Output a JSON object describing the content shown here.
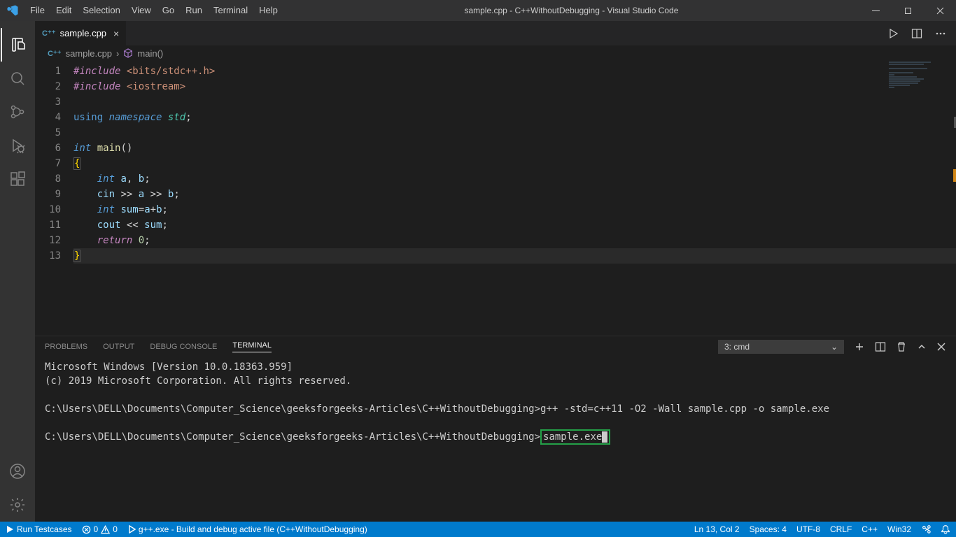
{
  "titlebar": {
    "menus": [
      "File",
      "Edit",
      "Selection",
      "View",
      "Go",
      "Run",
      "Terminal",
      "Help"
    ],
    "title": "sample.cpp - C++WithoutDebugging - Visual Studio Code"
  },
  "tab": {
    "filename": "sample.cpp"
  },
  "breadcrumb": {
    "file": "sample.cpp",
    "symbol": "main()"
  },
  "code": {
    "lines": [
      1,
      2,
      3,
      4,
      5,
      6,
      7,
      8,
      9,
      10,
      11,
      12,
      13
    ]
  },
  "panel": {
    "tabs": [
      "PROBLEMS",
      "OUTPUT",
      "DEBUG CONSOLE",
      "TERMINAL"
    ],
    "active_tab": "TERMINAL",
    "terminal_select": "3: cmd",
    "terminal_lines": {
      "l1": "Microsoft Windows [Version 10.0.18363.959]",
      "l2": "(c) 2019 Microsoft Corporation. All rights reserved.",
      "l3": "C:\\Users\\DELL\\Documents\\Computer_Science\\geeksforgeeks-Articles\\C++WithoutDebugging>g++ -std=c++11 -O2 -Wall sample.cpp -o sample.exe",
      "l4_prefix": "C:\\Users\\DELL\\Documents\\Computer_Science\\geeksforgeeks-Articles\\C++WithoutDebugging>",
      "l4_cmd": "sample.exe"
    }
  },
  "status": {
    "run": "Run Testcases",
    "errors": "0",
    "warnings": "0",
    "build": "g++.exe - Build and debug active file (C++WithoutDebugging)",
    "lncol": "Ln 13, Col 2",
    "spaces": "Spaces: 4",
    "encoding": "UTF-8",
    "eol": "CRLF",
    "lang": "C++",
    "platform": "Win32"
  }
}
